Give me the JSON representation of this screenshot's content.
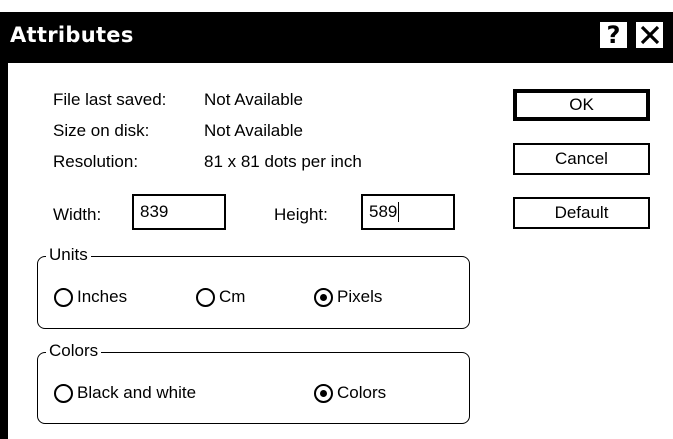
{
  "dialog": {
    "title": "Attributes"
  },
  "titlebar": {
    "help_label": "?",
    "close_icon": "close-icon"
  },
  "info": {
    "file_saved_label": "File last saved:",
    "file_saved_value": "Not Available",
    "size_label": "Size on disk:",
    "size_value": "Not Available",
    "resolution_label": "Resolution:",
    "resolution_value": "81 x 81 dots per inch"
  },
  "fields": {
    "width_label": "Width:",
    "width_value": "839",
    "height_label": "Height:",
    "height_value": "589"
  },
  "buttons": {
    "ok": "OK",
    "cancel": "Cancel",
    "default": "Default"
  },
  "units": {
    "legend": "Units",
    "options": [
      "Inches",
      "Cm",
      "Pixels"
    ],
    "selected": "Pixels"
  },
  "colors": {
    "legend": "Colors",
    "options": [
      "Black and white",
      "Colors"
    ],
    "selected": "Colors"
  }
}
